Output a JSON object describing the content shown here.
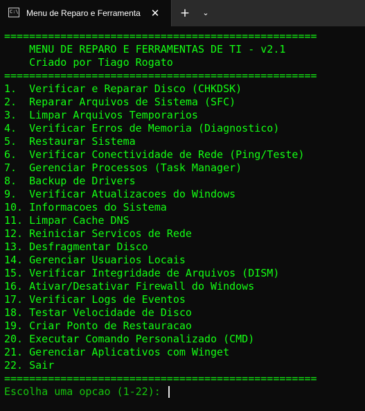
{
  "window": {
    "tab_title": "Menu de Reparo e Ferramenta",
    "tab_icon_text": "C:\\",
    "close_glyph": "✕",
    "new_tab_glyph": "+",
    "dropdown_glyph": "⌄"
  },
  "terminal": {
    "separator": "==================================================",
    "header_title": "    MENU DE REPARO E FERRAMENTAS DE TI - v2.1",
    "header_author": "    Criado por Tiago Rogato",
    "menu_items": [
      "1.  Verificar e Reparar Disco (CHKDSK)",
      "2.  Reparar Arquivos de Sistema (SFC)",
      "3.  Limpar Arquivos Temporarios",
      "4.  Verificar Erros de Memoria (Diagnostico)",
      "5.  Restaurar Sistema",
      "6.  Verificar Conectividade de Rede (Ping/Teste)",
      "7.  Gerenciar Processos (Task Manager)",
      "8.  Backup de Drivers",
      "9.  Verificar Atualizacoes do Windows",
      "10. Informacoes do Sistema",
      "11. Limpar Cache DNS",
      "12. Reiniciar Servicos de Rede",
      "13. Desfragmentar Disco",
      "14. Gerenciar Usuarios Locais",
      "15. Verificar Integridade de Arquivos (DISM)",
      "16. Ativar/Desativar Firewall do Windows",
      "17. Verificar Logs de Eventos",
      "18. Testar Velocidade de Disco",
      "19. Criar Ponto de Restauracao",
      "20. Executar Comando Personalizado (CMD)",
      "21. Gerenciar Aplicativos com Winget",
      "22. Sair"
    ],
    "prompt": "Escolha uma opcao (1-22): "
  },
  "colors": {
    "background": "#0c0c0c",
    "text_green": "#13ff13",
    "titlebar": "#2b2b2b"
  }
}
